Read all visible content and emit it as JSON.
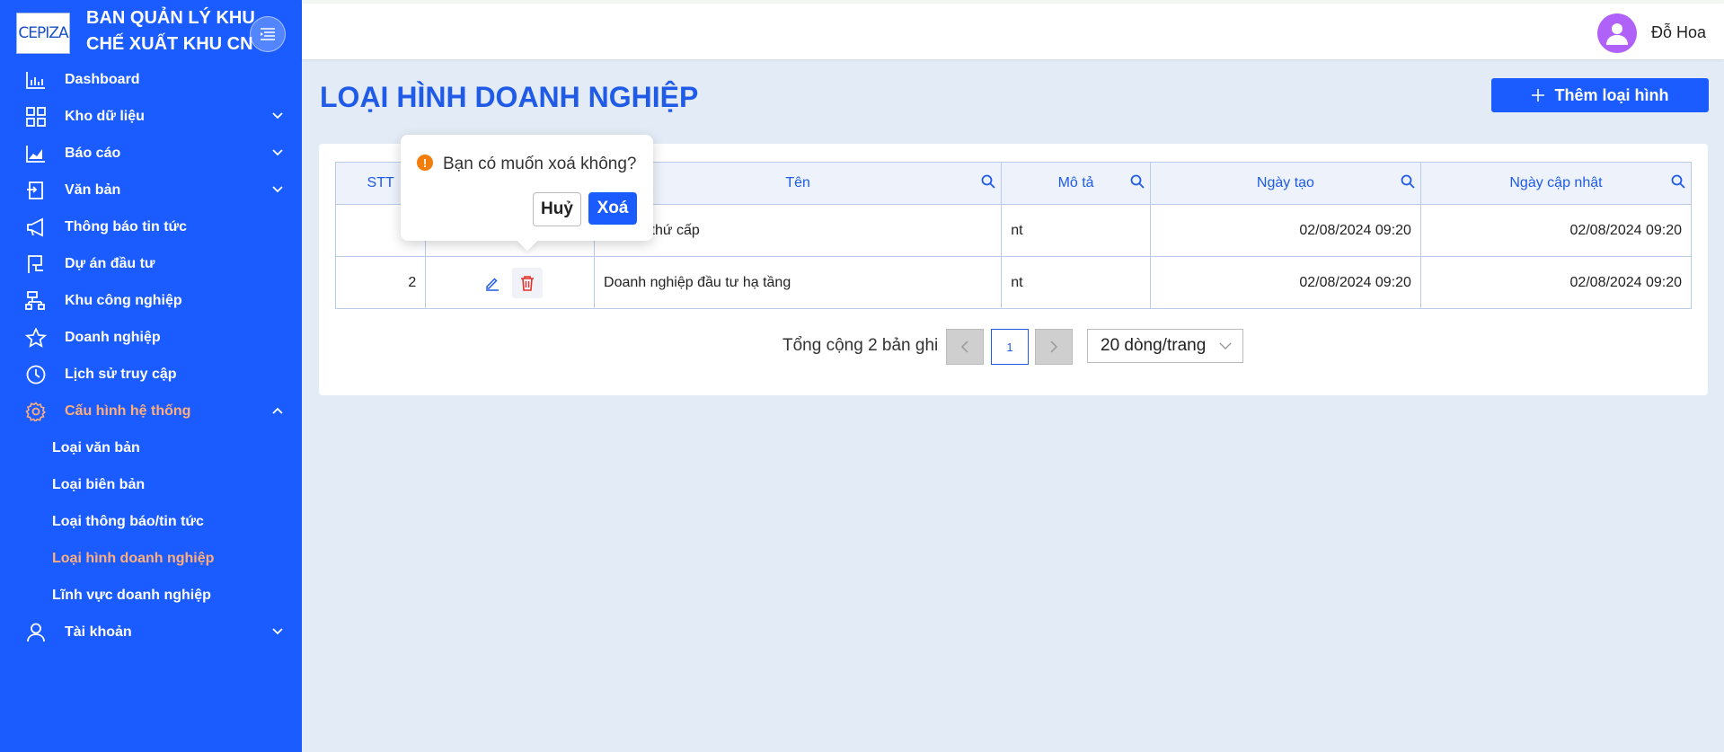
{
  "brand": {
    "logo_text": "CEPIZA",
    "name_line1": "BAN QUẢN LÝ KHU",
    "name_line2": "CHẾ XUẤT KHU CN"
  },
  "sidebar": {
    "items": [
      {
        "label": "Dashboard",
        "icon": "bar-chart-icon"
      },
      {
        "label": "Kho dữ liệu",
        "icon": "grid-icon",
        "has_children": true
      },
      {
        "label": "Báo cáo",
        "icon": "area-chart-icon",
        "has_children": true
      },
      {
        "label": "Văn bản",
        "icon": "document-icon",
        "has_children": true
      },
      {
        "label": "Thông báo tin tức",
        "icon": "megaphone-icon"
      },
      {
        "label": "Dự án đầu tư",
        "icon": "flag-icon"
      },
      {
        "label": "Khu công nghiệp",
        "icon": "cluster-icon"
      },
      {
        "label": "Doanh nghiệp",
        "icon": "star-icon"
      },
      {
        "label": "Lịch sử truy cập",
        "icon": "clock-icon"
      },
      {
        "label": "Cấu hình hệ thống",
        "icon": "gear-icon",
        "active": true,
        "expanded": true
      },
      {
        "label": "Tài khoản",
        "icon": "user-icon",
        "has_children": true
      }
    ],
    "sub_items": [
      {
        "label": "Loại văn bản"
      },
      {
        "label": "Loại biên bản"
      },
      {
        "label": "Loại thông báo/tin tức"
      },
      {
        "label": "Loại hình doanh nghiệp",
        "active": true
      },
      {
        "label": "Lĩnh vực doanh nghiệp"
      }
    ],
    "active_color": "#ffae78",
    "bg_color": "#1a5cff"
  },
  "header": {
    "username": "Đỗ Hoa",
    "avatar_color": "#b061f7"
  },
  "main": {
    "title": "LOẠI HÌNH DOANH NGHIỆP",
    "add_button_label": "Thêm loại hình"
  },
  "table": {
    "columns": [
      "STT",
      "",
      "Tên",
      "Mô tả",
      "Ngày tạo",
      "Ngày cập nhật"
    ],
    "rows": [
      {
        "stt": "",
        "name": "nghiệp thứ cấp",
        "desc": "nt",
        "created": "02/08/2024 09:20",
        "updated": "02/08/2024 09:20"
      },
      {
        "stt": "2",
        "name": "Doanh nghiệp đầu tư hạ tầng",
        "desc": "nt",
        "created": "02/08/2024 09:20",
        "updated": "02/08/2024 09:20"
      }
    ]
  },
  "pagination": {
    "total_text": "Tổng cộng 2 bản ghi",
    "current_page": "1",
    "page_size": "20 dòng/trang"
  },
  "popconfirm": {
    "message": "Bạn có muốn xoá không?",
    "cancel_label": "Huỷ",
    "ok_label": "Xoá"
  }
}
